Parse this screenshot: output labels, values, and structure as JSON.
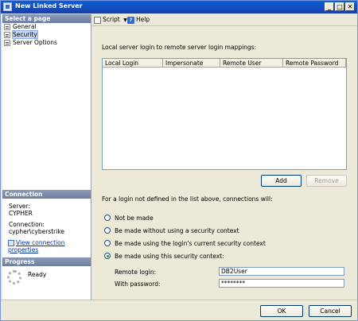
{
  "window": {
    "title": "New Linked Server",
    "controls": {
      "minimize": "_",
      "maximize": "□",
      "close": "✕"
    }
  },
  "sidebar": {
    "pages_header": "Select a page",
    "pages": [
      {
        "label": "General",
        "icon": "page-icon"
      },
      {
        "label": "Security",
        "icon": "page-icon",
        "selected": true
      },
      {
        "label": "Server Options",
        "icon": "page-icon"
      }
    ],
    "connection_header": "Connection",
    "server_label": "Server:",
    "server_value": "CYPHER",
    "connection_label": "Connection:",
    "connection_value": "cypher\\cyberstrike",
    "view_props_link": "View connection properties",
    "progress_header": "Progress",
    "progress_status": "Ready"
  },
  "toolbar": {
    "script_label": "Script",
    "help_label": "Help"
  },
  "main": {
    "mappings_label": "Local server login to remote server login mappings:",
    "columns": [
      "Local Login",
      "Impersonate",
      "Remote User",
      "Remote Password"
    ],
    "rows": [],
    "add_button": "Add",
    "remove_button": "Remove",
    "fallback_label": "For a login not defined in the list above, connections will:",
    "options": [
      {
        "label": "Not be made",
        "selected": false
      },
      {
        "label": "Be made without using a security context",
        "selected": false
      },
      {
        "label": "Be made using the login's current security context",
        "selected": false
      },
      {
        "label": "Be made using this security context:",
        "selected": true
      }
    ],
    "remote_login_label": "Remote login:",
    "remote_login_value": "DB2User",
    "password_label": "With password:",
    "password_value": "********"
  },
  "footer": {
    "ok_button": "OK",
    "cancel_button": "Cancel"
  },
  "colors": {
    "titlebar": "#0a5fd8",
    "section_header": "#7a8aa8",
    "link": "#0033aa",
    "radio_selected": "#21a121"
  }
}
